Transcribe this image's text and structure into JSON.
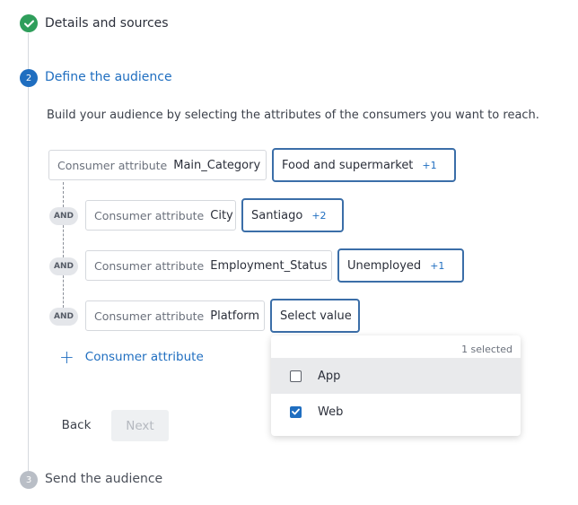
{
  "steps": [
    {
      "number": "",
      "label": "Details and sources",
      "state": "complete",
      "icon": "check-icon"
    },
    {
      "number": "2",
      "label": "Define the audience",
      "state": "active"
    },
    {
      "number": "3",
      "label": "Send the audience",
      "state": "pending"
    }
  ],
  "description": "Build your audience by selecting the attributes of the consumers you want to reach.",
  "attribute_prefix": "Consumer attribute",
  "connector": "AND",
  "rows": [
    {
      "attribute": "Main_Category",
      "value": "Food and supermarket",
      "extra": "+1"
    },
    {
      "attribute": "City",
      "value": "Santiago",
      "extra": "+2"
    },
    {
      "attribute": "Employment_Status",
      "value": "Unemployed",
      "extra": "+1"
    },
    {
      "attribute": "Platform",
      "value": "Select value",
      "extra": ""
    }
  ],
  "add_attribute": {
    "icon": "plus-icon",
    "label": "Consumer attribute"
  },
  "buttons": {
    "back": "Back",
    "next": "Next"
  },
  "dropdown": {
    "selected_count": "1 selected",
    "options": [
      {
        "label": "App",
        "checked": false
      },
      {
        "label": "Web",
        "checked": true
      }
    ]
  },
  "colors": {
    "accent": "#1f6ec0",
    "complete": "#2f9e5b",
    "pending": "#b9bec6",
    "value_border": "#3b6ea8"
  }
}
